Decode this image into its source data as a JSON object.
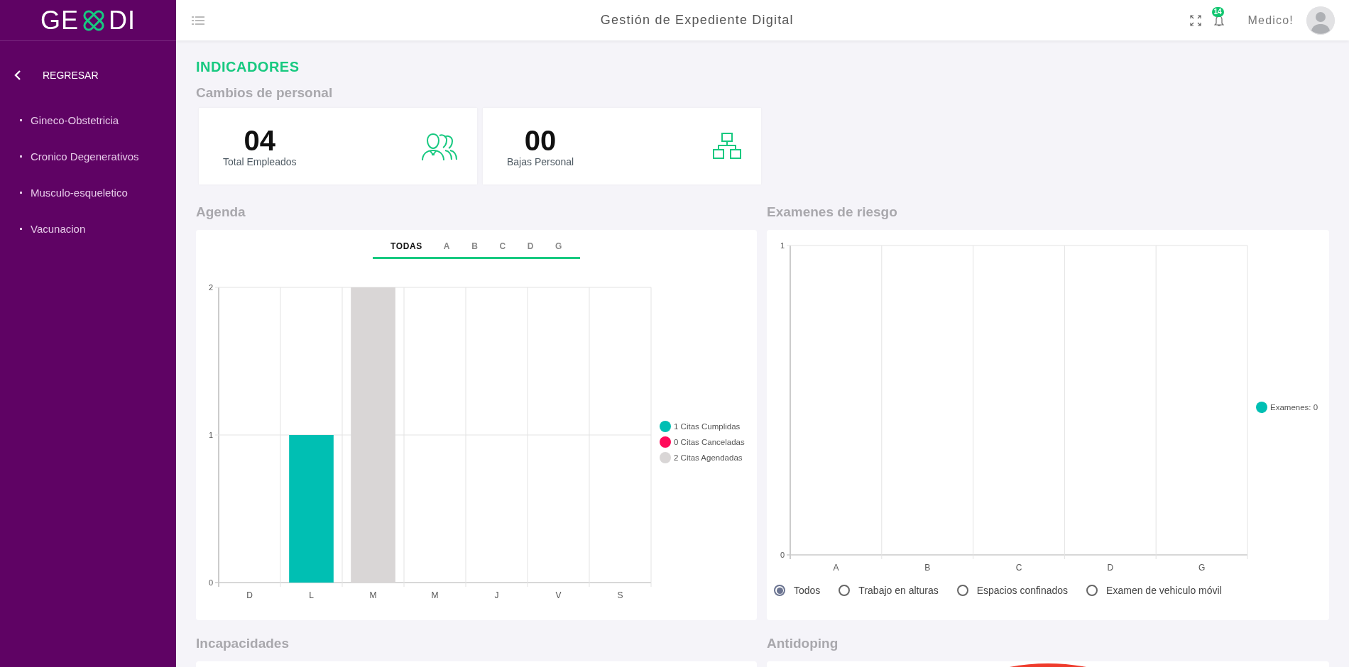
{
  "sidebar": {
    "logo": {
      "left": "GE",
      "right": "DI"
    },
    "back": {
      "label": "REGRESAR"
    },
    "items": [
      {
        "label": "Gineco-Obstetricia"
      },
      {
        "label": "Cronico Degenerativos"
      },
      {
        "label": "Musculo-esqueletico"
      },
      {
        "label": "Vacunacion"
      }
    ]
  },
  "header": {
    "title": "Gestión de Expediente Digital",
    "notifications": "14",
    "user": "Medico!"
  },
  "page_title": "INDICADORES",
  "staff": {
    "title": "Cambios de personal",
    "cards": [
      {
        "value": "04",
        "label": "Total Empleados",
        "kind": "people"
      },
      {
        "value": "00",
        "label": "Bajas Personal",
        "kind": "hierarchy"
      }
    ]
  },
  "agenda": {
    "title": "Agenda",
    "tabs": [
      {
        "label": "TODAS",
        "selected": true
      },
      {
        "label": "A",
        "selected": false
      },
      {
        "label": "B",
        "selected": false
      },
      {
        "label": "C",
        "selected": false
      },
      {
        "label": "D",
        "selected": false
      },
      {
        "label": "G",
        "selected": false
      }
    ],
    "chart_data": {
      "type": "bar",
      "categories": [
        "D",
        "L",
        "M",
        "M",
        "J",
        "V",
        "S"
      ],
      "series": [
        {
          "name": "1 Citas Cumplidas",
          "color": "#00bfb3",
          "values": [
            0,
            1,
            0,
            0,
            0,
            0,
            0
          ]
        },
        {
          "name": "0 Citas Canceladas",
          "color": "#ff0a5a",
          "values": [
            0,
            0,
            0,
            0,
            0,
            0,
            0
          ]
        },
        {
          "name": "2 Citas Agendadas",
          "color": "#d9d6d6",
          "values": [
            0,
            0,
            2,
            0,
            0,
            0,
            0
          ]
        }
      ],
      "ylim": [
        0,
        2
      ],
      "yticks": [
        0,
        1,
        2
      ],
      "stacked": true
    }
  },
  "exams": {
    "title": "Examenes de riesgo",
    "chart_data": {
      "type": "bar",
      "categories": [
        "A",
        "B",
        "C",
        "D",
        "G"
      ],
      "series": [
        {
          "name": "Examenes: 0",
          "color": "#00bfb3",
          "values": [
            0,
            0,
            0,
            0,
            0
          ]
        }
      ],
      "ylim": [
        0,
        1
      ],
      "yticks": [
        0,
        1
      ]
    },
    "filters": [
      {
        "label": "Todos",
        "selected": true
      },
      {
        "label": "Trabajo en alturas",
        "selected": false
      },
      {
        "label": "Espacios confinados",
        "selected": false
      },
      {
        "label": "Examen de vehiculo móvil",
        "selected": false
      }
    ]
  },
  "disabilities": {
    "title": "Incapacidades"
  },
  "antidoping": {
    "title": "Antidoping"
  }
}
